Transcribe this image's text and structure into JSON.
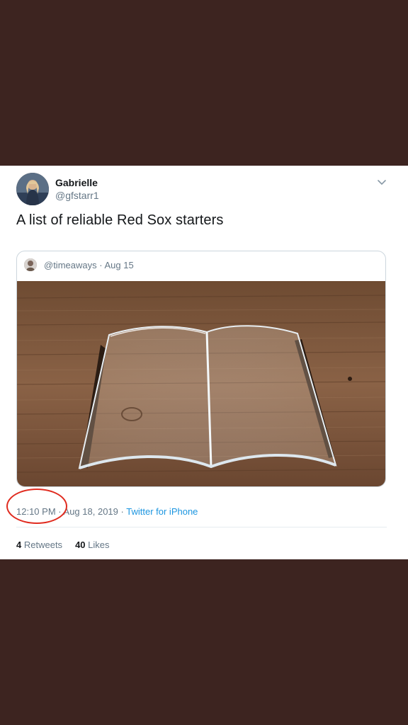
{
  "tweet": {
    "display_name": "Gabrielle",
    "handle": "@gfstarr1",
    "text": "A list of reliable Red Sox starters"
  },
  "quoted": {
    "handle": "@timeaways",
    "separator": "·",
    "date": "Aug 15",
    "image_description_icon": "acrylic-open-book-image"
  },
  "meta": {
    "time": "12:10 PM",
    "sep1": "·",
    "date": "Aug 18, 2019",
    "sep2": "·",
    "source": "Twitter for iPhone"
  },
  "stats": {
    "retweets_count": "4",
    "retweets_label": "Retweets",
    "likes_count": "40",
    "likes_label": "Likes"
  },
  "colors": {
    "background": "#3d2420",
    "card": "#ffffff",
    "link": "#1b95e0",
    "annotation_circle": "#e02b1f"
  }
}
